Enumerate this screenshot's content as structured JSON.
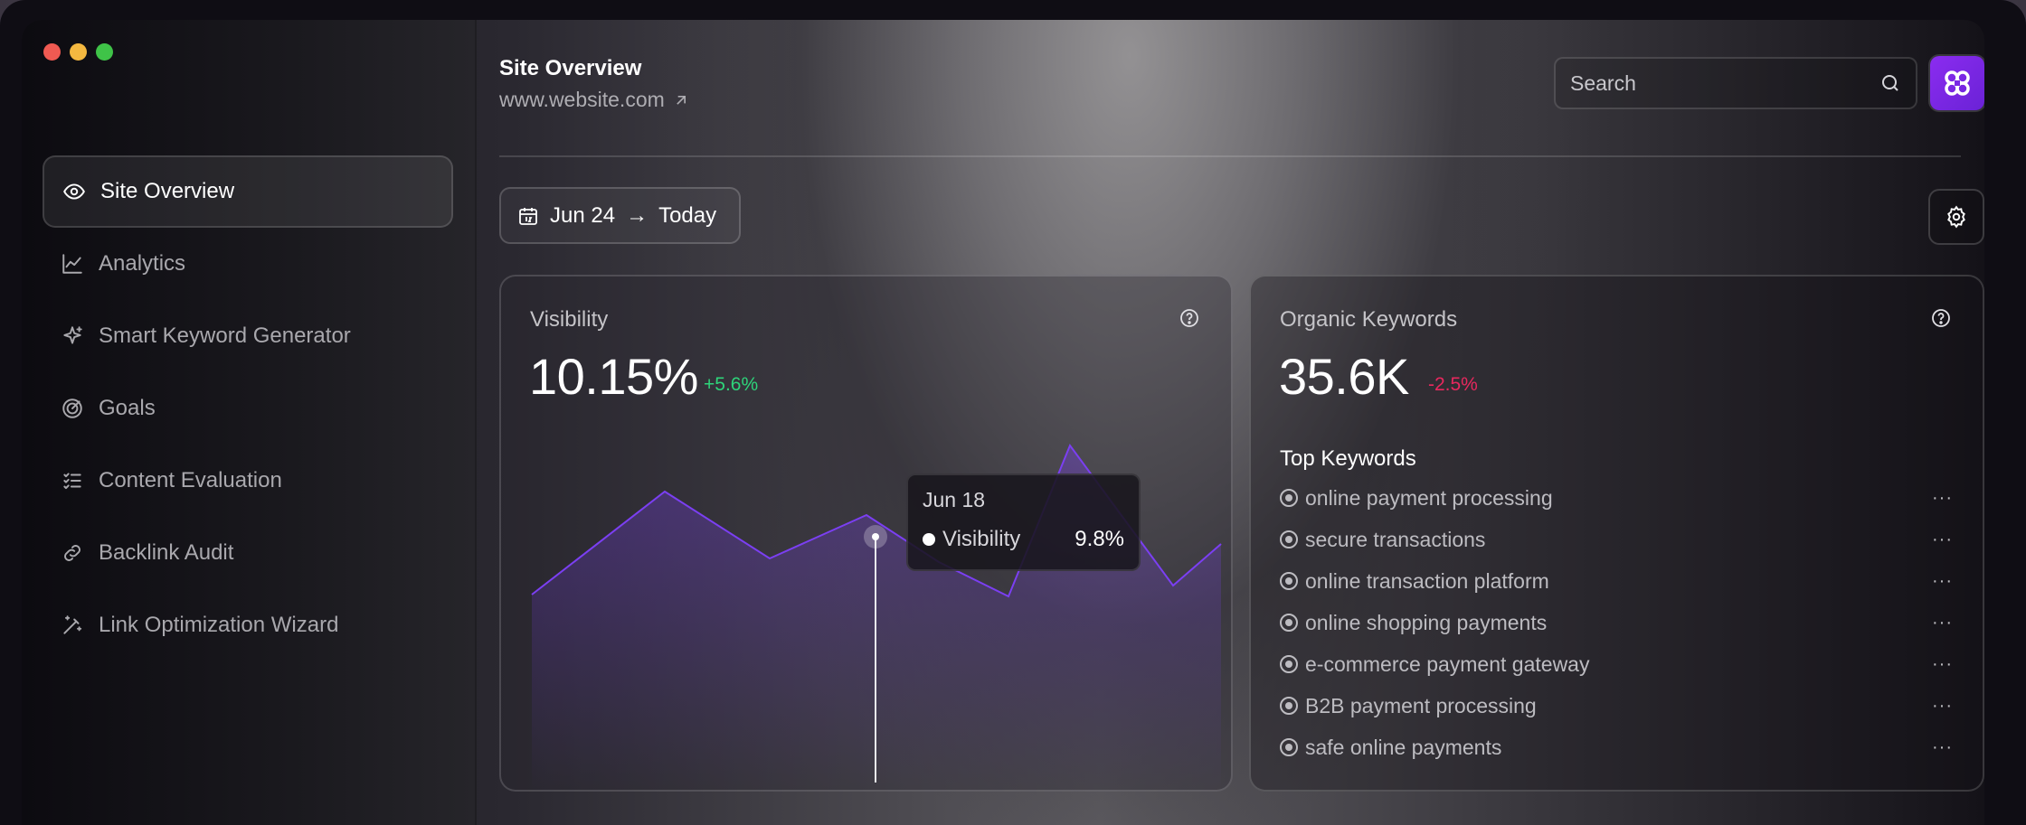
{
  "window": {
    "controls": [
      "close",
      "minimize",
      "maximize"
    ]
  },
  "sidebar": {
    "items": [
      {
        "label": "Site Overview",
        "icon": "eye-icon",
        "active": true
      },
      {
        "label": "Analytics",
        "icon": "line-chart-icon"
      },
      {
        "label": "Smart Keyword Generator",
        "icon": "sparkle-icon"
      },
      {
        "label": "Goals",
        "icon": "target-icon"
      },
      {
        "label": "Content Evaluation",
        "icon": "checklist-icon"
      },
      {
        "label": "Backlink Audit",
        "icon": "link-icon"
      },
      {
        "label": "Link Optimization Wizard",
        "icon": "magic-wand-icon"
      }
    ]
  },
  "header": {
    "title": "Site Overview",
    "url": "www.website.com"
  },
  "search": {
    "placeholder": "Search"
  },
  "date_range": {
    "from": "Jun 24",
    "arrow": "→",
    "to": "Today"
  },
  "visibility_card": {
    "label": "Visibility",
    "value": "10.15%",
    "delta": "+5.6%",
    "tooltip": {
      "date": "Jun 18",
      "series": "Visibility",
      "value": "9.8%"
    }
  },
  "keywords_card": {
    "label": "Organic Keywords",
    "value": "35.6K",
    "delta": "-2.5%",
    "top_title": "Top Keywords",
    "keywords": [
      "online payment processing",
      "secure transactions",
      "online transaction platform",
      "online shopping payments",
      "e-commerce payment gateway",
      "B2B payment processing",
      "safe online payments"
    ],
    "more": "···"
  },
  "colors": {
    "accent": "#7b3ff2",
    "positive": "#2ed47a",
    "negative": "#e8285e"
  }
}
